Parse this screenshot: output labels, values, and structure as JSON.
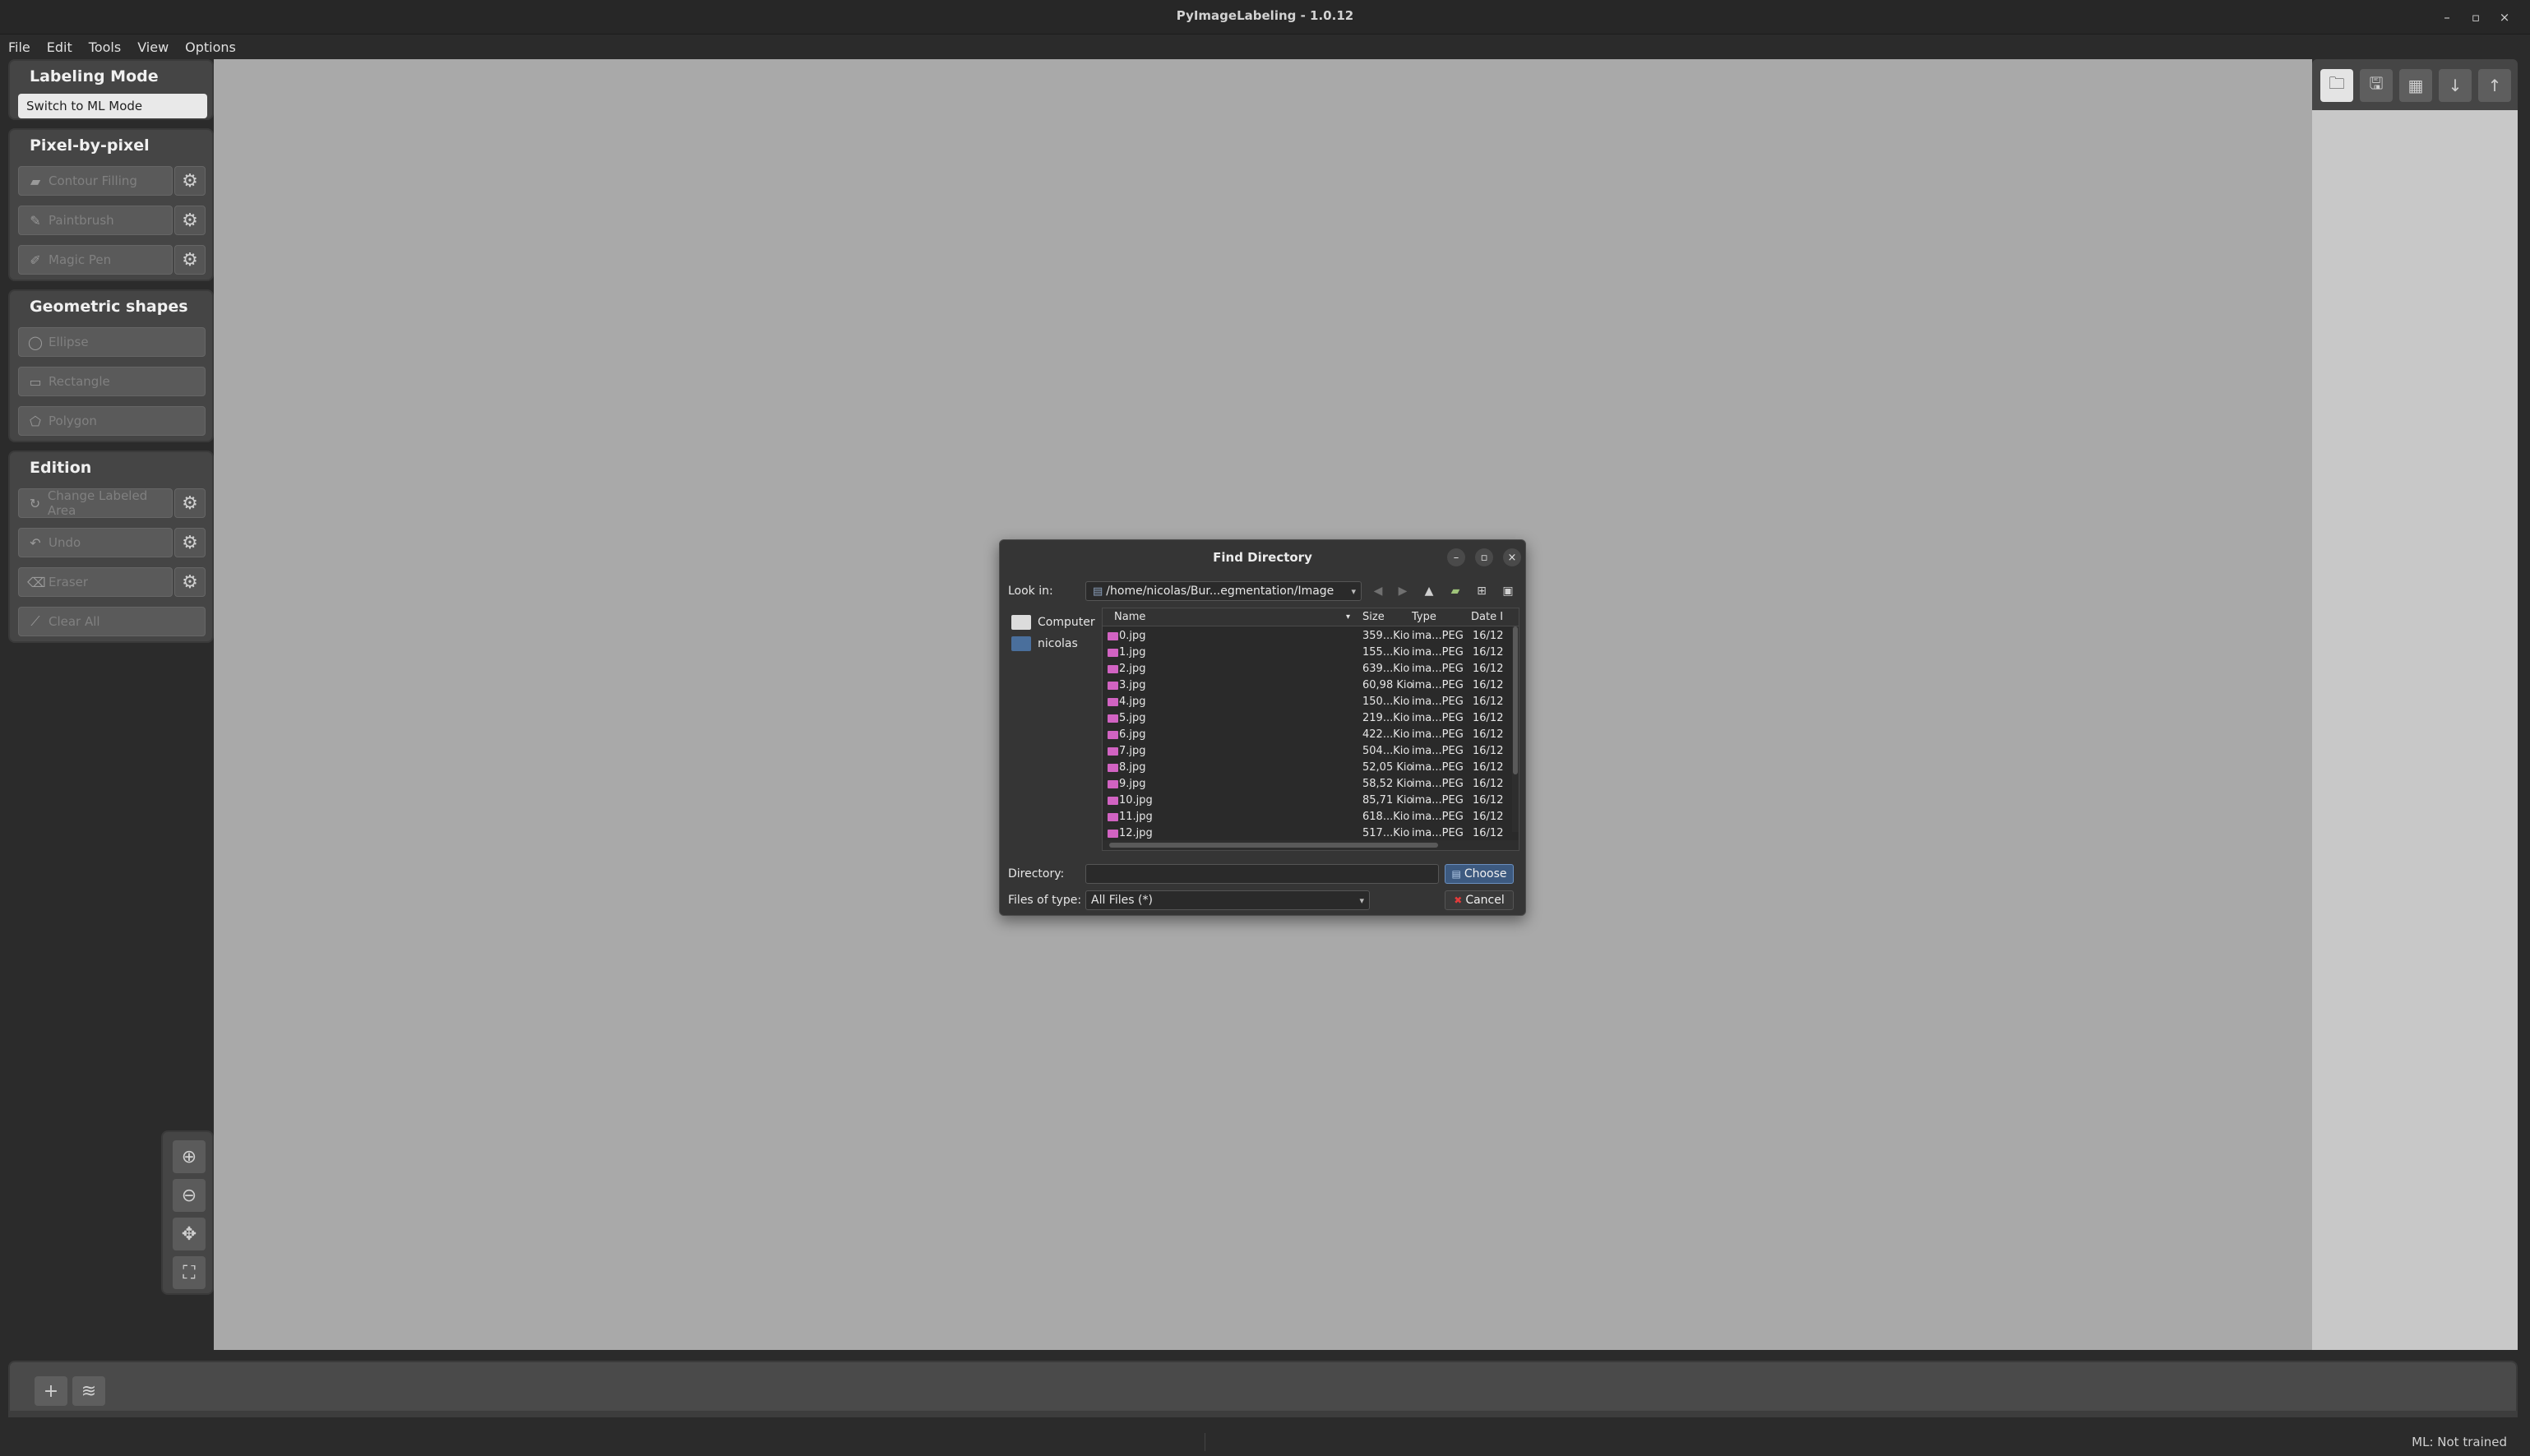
{
  "window": {
    "title": "PyImageLabeling - 1.0.12",
    "minimize_icon": "–",
    "maximize_icon": "▫",
    "close_icon": "×"
  },
  "menu": [
    "File",
    "Edit",
    "Tools",
    "View",
    "Options"
  ],
  "left_panel": {
    "labeling_mode": {
      "title": "Labeling Mode",
      "switch_button": "Switch to ML Mode"
    },
    "pixel_group": {
      "title": "Pixel-by-pixel",
      "tools": [
        "Contour Filling",
        "Paintbrush",
        "Magic Pen"
      ]
    },
    "geometric_group": {
      "title": "Geometric shapes",
      "tools": [
        "Ellipse",
        "Rectangle",
        "Polygon"
      ]
    },
    "edition_group": {
      "title": "Edition",
      "tools": [
        "Change Labeled Area",
        "Undo",
        "Eraser",
        "Clear All"
      ]
    }
  },
  "dialog": {
    "title": "Find Directory",
    "look_in_label": "Look in:",
    "look_in_value": "/home/nicolas/Bur...egmentation/Image",
    "places": [
      "Computer",
      "nicolas"
    ],
    "columns": {
      "name": "Name",
      "size": "Size",
      "type": "Type",
      "date": "Date I"
    },
    "files": [
      {
        "name": "0.jpg",
        "size": "359...Kio",
        "type": "ima...PEG",
        "date": "16/12"
      },
      {
        "name": "1.jpg",
        "size": "155...Kio",
        "type": "ima...PEG",
        "date": "16/12"
      },
      {
        "name": "2.jpg",
        "size": "639...Kio",
        "type": "ima...PEG",
        "date": "16/12"
      },
      {
        "name": "3.jpg",
        "size": "60,98 Kio",
        "type": "ima...PEG",
        "date": "16/12"
      },
      {
        "name": "4.jpg",
        "size": "150...Kio",
        "type": "ima...PEG",
        "date": "16/12"
      },
      {
        "name": "5.jpg",
        "size": "219...Kio",
        "type": "ima...PEG",
        "date": "16/12"
      },
      {
        "name": "6.jpg",
        "size": "422...Kio",
        "type": "ima...PEG",
        "date": "16/12"
      },
      {
        "name": "7.jpg",
        "size": "504...Kio",
        "type": "ima...PEG",
        "date": "16/12"
      },
      {
        "name": "8.jpg",
        "size": "52,05 Kio",
        "type": "ima...PEG",
        "date": "16/12"
      },
      {
        "name": "9.jpg",
        "size": "58,52 Kio",
        "type": "ima...PEG",
        "date": "16/12"
      },
      {
        "name": "10.jpg",
        "size": "85,71 Kio",
        "type": "ima...PEG",
        "date": "16/12"
      },
      {
        "name": "11.jpg",
        "size": "618...Kio",
        "type": "ima...PEG",
        "date": "16/12"
      },
      {
        "name": "12.jpg",
        "size": "517...Kio",
        "type": "ima...PEG",
        "date": "16/12"
      }
    ],
    "directory_label": "Directory:",
    "directory_value": "",
    "files_of_type_label": "Files of type:",
    "files_of_type_value": "All Files (*)",
    "choose_button": "Choose",
    "cancel_button": "Cancel"
  },
  "status": {
    "ml_status": "ML: Not trained"
  },
  "icons": {
    "gear": "⚙",
    "zoom_in": "⊕",
    "zoom_out": "⊖",
    "move": "✥",
    "reset_view": "⛶",
    "open_folder": "🗀",
    "save": "🖫",
    "save_all": "▦",
    "download": "↓",
    "upload": "↑",
    "add": "+",
    "layers": "≋"
  },
  "colors": {
    "canvas": "#a9a9a9",
    "accent_choose": "#3d5a80",
    "file_icon": "#d163c2",
    "cancel_icon": "#e23b3b"
  }
}
